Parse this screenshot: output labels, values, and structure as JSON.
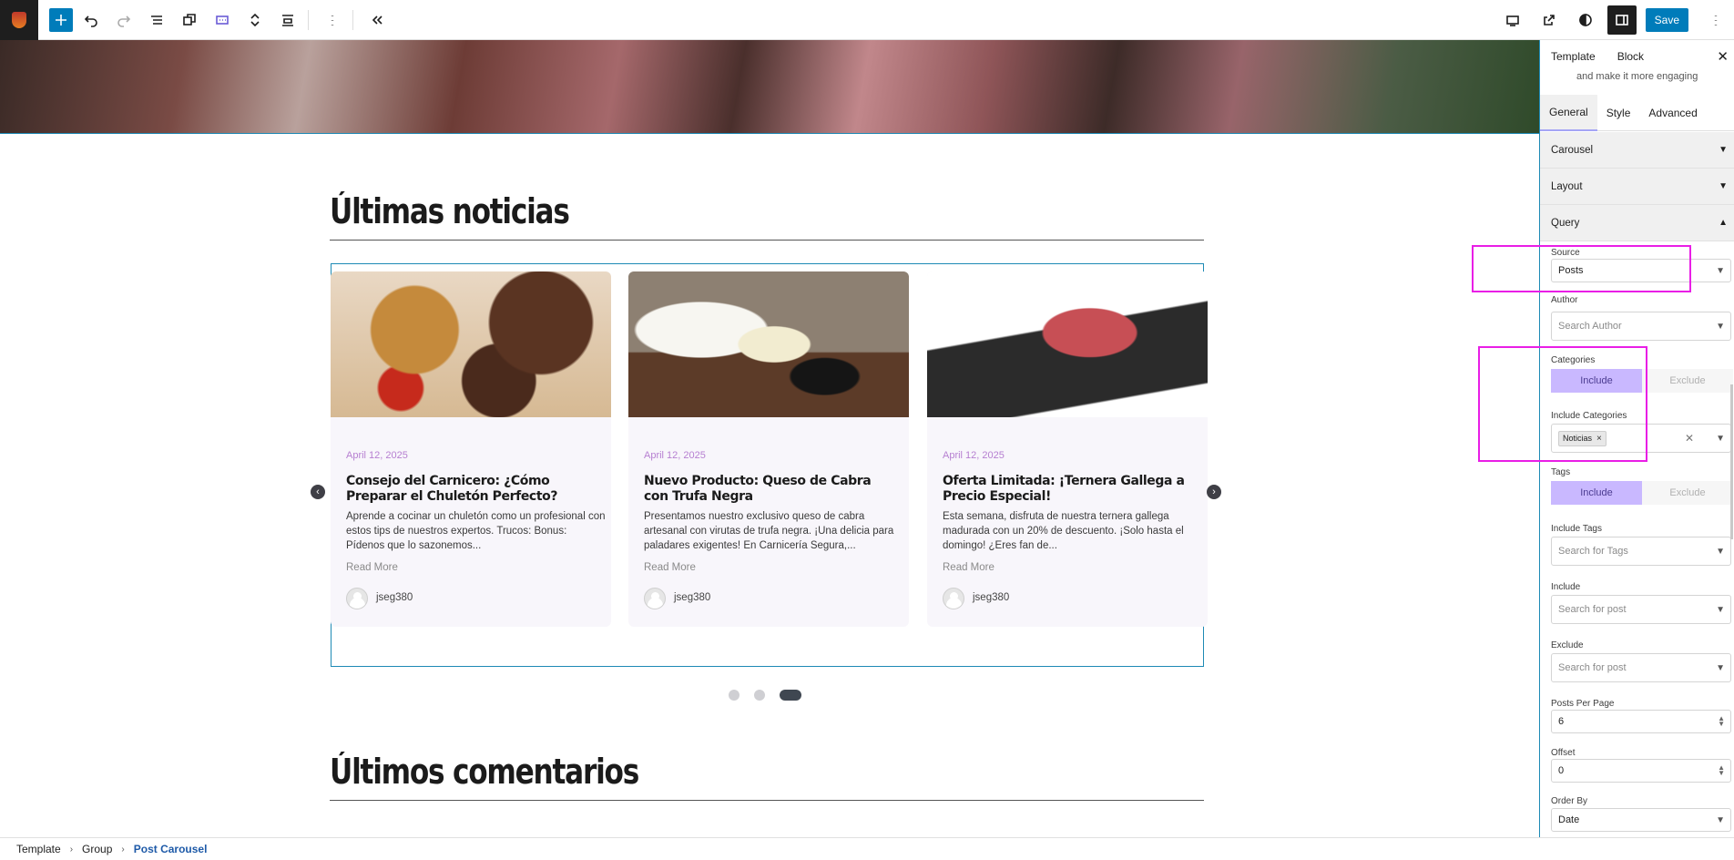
{
  "toolbar": {
    "save_label": "Save",
    "icons": [
      "plus-icon",
      "undo-icon",
      "redo-icon",
      "list-view-icon",
      "copy-icon",
      "carousel-block-icon",
      "move-arrows-icon",
      "align-icon",
      "more-vertical-icon",
      "collapse-icon",
      "desktop-view-icon",
      "external-link-icon",
      "contrast-icon",
      "settings-panel-icon",
      "more-vertical-icon"
    ],
    "accent": "#007cba"
  },
  "canvas": {
    "heading_news": "Últimas noticias",
    "heading_comments": "Últimos comentarios",
    "carousel": {
      "posts": [
        {
          "date": "April 12, 2025",
          "title": "Consejo del Carnicero: ¿Cómo Preparar el Chuletón Perfecto?",
          "excerpt": "Aprende a cocinar un chuletón como un profesional con estos tips de nuestros expertos. Trucos: Bonus: Pídenos que lo sazonemos...",
          "read_more": "Read More",
          "author": "jseg380"
        },
        {
          "date": "April 12, 2025",
          "title": "Nuevo Producto: Queso de Cabra con Trufa Negra",
          "excerpt": "Presentamos nuestro exclusivo queso de cabra artesanal con virutas de trufa negra. ¡Una delicia para paladares exigentes! En Carnicería Segura,...",
          "read_more": "Read More",
          "author": "jseg380"
        },
        {
          "date": "April 12, 2025",
          "title": "Oferta Limitada: ¡Ternera Gallega a Precio Especial!",
          "excerpt": "Esta semana, disfruta de nuestra ternera gallega madurada con un 20% de descuento. ¡Solo hasta el domingo! ¿Eres fan de...",
          "read_more": "Read More",
          "author": "jseg380"
        }
      ],
      "prev_arrow": "‹",
      "next_arrow": "›",
      "dots_count": 3,
      "active_dot": 3
    }
  },
  "sidebar": {
    "tabs": [
      "Template",
      "Block"
    ],
    "close": "✕",
    "description": "and make it more engaging",
    "inner_tabs": [
      "General",
      "Style",
      "Advanced"
    ],
    "panels": {
      "carousel": "Carousel",
      "layout": "Layout",
      "query": "Query"
    },
    "query": {
      "source_label": "Source",
      "source_value": "Posts",
      "author_label": "Author",
      "author_placeholder": "Search Author",
      "categories_label": "Categories",
      "include_label": "Include",
      "exclude_label": "Exclude",
      "include_categories_label": "Include Categories",
      "category_chip": "Noticias",
      "chip_remove": "×",
      "clear_symbol": "✕",
      "tags_label": "Tags",
      "include_tags_label": "Include Tags",
      "include_tags_placeholder": "Search for Tags",
      "include_posts_label": "Include",
      "include_posts_placeholder": "Search for post",
      "exclude_posts_label": "Exclude",
      "exclude_posts_placeholder": "Search for post",
      "posts_per_page_label": "Posts Per Page",
      "posts_per_page_value": "6",
      "offset_label": "Offset",
      "offset_value": "0",
      "order_by_label": "Order By",
      "order_by_value": "Date"
    }
  },
  "breadcrumb": [
    "Template",
    "Group",
    "Post Carousel"
  ],
  "colors": {
    "accent": "#007cba",
    "highlight": "#e91ee6",
    "date": "#b67fd1",
    "include_active": "#c9b8ff"
  }
}
